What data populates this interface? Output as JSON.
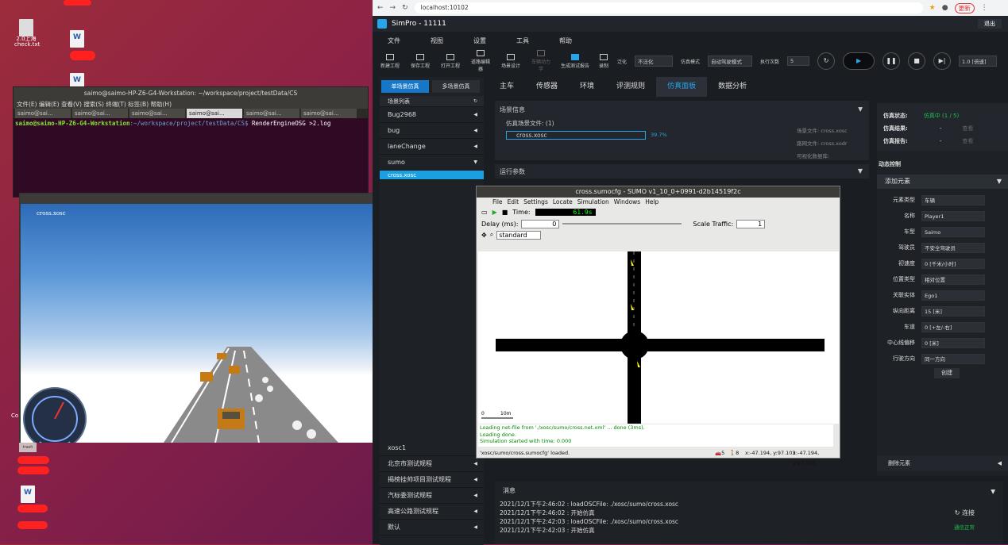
{
  "desktop": {
    "icons": [
      {
        "label": "2.0上海\ncheck.txt"
      }
    ],
    "trash_label": "trash",
    "left_edge_text": "Co"
  },
  "terminal": {
    "title": "saimo@saimo-HP-Z6-G4-Workstation: ~/workspace/project/testData/CS",
    "menu": "文件(E)  编辑(E)  查看(V)  搜索(S)  终端(T)  标签(B)  帮助(H)",
    "tabs": [
      "saimo@sai...",
      "saimo@sai...",
      "saimo@sai...",
      "saimo@sai...",
      "saimo@sai...",
      "saimo@sai..."
    ],
    "prompt_user": "saimo@saimo-HP-Z6-G4-Workstation",
    "prompt_path": ":~/workspace/project/testData/CS$",
    "command": " RenderEngineOSG >2.log"
  },
  "view3d": {
    "overlay_label": "cross.xosc"
  },
  "browser": {
    "url": "localhost:10102",
    "update_label": "更新",
    "app_title": "SimPro - 11111",
    "exit_label": "退出",
    "menu": [
      "文件",
      "视图",
      "设置",
      "工具",
      "帮助"
    ],
    "toolbar": [
      "新建工程",
      "保存工程",
      "打开工程",
      "道路编辑器",
      "场景设计",
      "车辆动力学",
      "生成测试报告",
      "录制"
    ],
    "generalize_label": "泛化",
    "generalize_value": "不泛化",
    "sim_mode_label": "仿真模式",
    "sim_mode_value": "自动驾驶模式",
    "exec_label": "执行次数",
    "exec_value": "5",
    "speed": "1.0 [倍速]",
    "left": {
      "tabs": [
        "单场景仿真",
        "多场景仿真"
      ],
      "list_title": "场景列表",
      "items": [
        "Bug2968",
        "bug",
        "laneChange",
        "sumo"
      ],
      "selected": "cross.xosc",
      "bottom_items": [
        "xosc1",
        "北京市测试规程",
        "揭榜挂帅项目测试规程",
        "汽标委测试规程",
        "高速公路测试规程",
        "默认"
      ]
    },
    "tabs": [
      "主车",
      "传感器",
      "环境",
      "评测规则",
      "仿真面板",
      "数据分析"
    ],
    "scene_info": {
      "title": "场景信息",
      "file_label": "仿真场景文件: (1)",
      "file": "cross.xosc",
      "progress": "39.7%",
      "scene_file": "场景文件: cross.xosc",
      "road_file": "路网文件: cross.xodr",
      "viz_db": "可视化数据库:"
    },
    "run_params": "运行参数",
    "status": {
      "state_label": "仿真状态:",
      "state_value": "仿真中 (1 / 5)",
      "result_label": "仿真结果:",
      "result_value": "-",
      "report_label": "仿真报告:",
      "report_value": "-",
      "view": "查看"
    },
    "dynamic": {
      "title": "动态控制",
      "add": "添加元素",
      "rows": [
        [
          "元素类型",
          "车辆"
        ],
        [
          "名称",
          "Player1"
        ],
        [
          "车型",
          "Saimo"
        ],
        [
          "驾驶员",
          "不安全驾驶员"
        ],
        [
          "初速度",
          "0   [千米/小时]"
        ],
        [
          "位置类型",
          "相对位置"
        ],
        [
          "关联实体",
          "Ego1"
        ],
        [
          "纵向距离",
          "15   [米]"
        ],
        [
          "车道",
          "0   [+左/-右]"
        ],
        [
          "中心线偏移",
          "0   [米]"
        ],
        [
          "行驶方向",
          "同一方向"
        ]
      ],
      "create": "创建",
      "delete": "删除元素"
    },
    "messages": {
      "title": "消息",
      "lines": [
        "2021/12/1下午2:46:02 : loadOSCFile: ./xosc/sumo/cross.xosc",
        "2021/12/1下午2:46:02 : 开始仿真",
        "2021/12/1下午2:42:03 : loadOSCFile: ./xosc/sumo/cross.xosc",
        "2021/12/1下午2:42:03 : 开始仿真"
      ],
      "connect": "连接",
      "comm_ok": "通信正常"
    }
  },
  "sumo": {
    "title": "cross.sumocfg - SUMO v1_10_0+0991-d2b14519f2c",
    "menu": [
      "File",
      "Edit",
      "Settings",
      "Locate",
      "Simulation",
      "Windows",
      "Help"
    ],
    "time_label": "Time:",
    "time": "61.9s",
    "delay_label": "Delay (ms):",
    "delay": "0",
    "scale_label": "Scale Traffic:",
    "scale": "1",
    "scheme": "standard",
    "scale_bar": "10m",
    "scale_zero": "0",
    "log": [
      "Loading net-file from './xosc/sumo/cross.net.xml' ... done (3ms).",
      "Loading done.",
      "Simulation started with time: 0.000"
    ],
    "status": "'xosc/sumo/cross.sumocfg' loaded.",
    "count_a": "5",
    "count_b": "8",
    "coord1": "x:-47.194, y:97.103",
    "coord2": "x:-47.194, y:97.103"
  },
  "colors": {
    "accent": "#2aa4e8",
    "green": "#19c24a"
  }
}
